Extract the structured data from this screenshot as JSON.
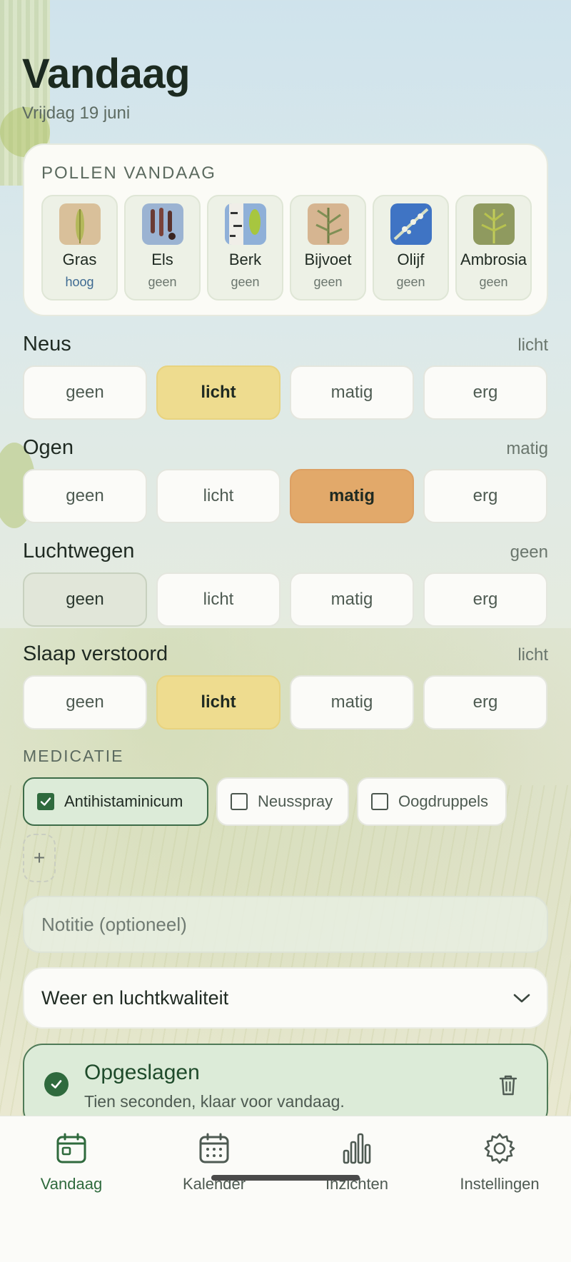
{
  "header": {
    "title": "Vandaag",
    "date": "Vrijdag 19 juni"
  },
  "pollen": {
    "heading": "POLLEN VANDAAG",
    "items": [
      {
        "name": "Gras",
        "level": "hoog",
        "icon": "grass-pollen-icon"
      },
      {
        "name": "Els",
        "level": "geen",
        "icon": "alder-pollen-icon"
      },
      {
        "name": "Berk",
        "level": "geen",
        "icon": "birch-pollen-icon"
      },
      {
        "name": "Bijvoet",
        "level": "geen",
        "icon": "mugwort-pollen-icon"
      },
      {
        "name": "Olijf",
        "level": "geen",
        "icon": "olive-pollen-icon"
      },
      {
        "name": "Ambrosia",
        "level": "geen",
        "icon": "ragweed-pollen-icon"
      }
    ]
  },
  "options": [
    "geen",
    "licht",
    "matig",
    "erg"
  ],
  "symptoms": [
    {
      "title": "Neus",
      "value": "licht"
    },
    {
      "title": "Ogen",
      "value": "matig"
    },
    {
      "title": "Luchtwegen",
      "value": "geen"
    },
    {
      "title": "Slaap verstoord",
      "value": "licht"
    }
  ],
  "medication": {
    "heading": "MEDICATIE",
    "items": [
      {
        "label": "Antihistaminicum",
        "checked": true
      },
      {
        "label": "Neusspray",
        "checked": false
      },
      {
        "label": "Oogdruppels",
        "checked": false
      }
    ],
    "add_label": "+"
  },
  "note": {
    "placeholder": "Notitie (optioneel)"
  },
  "weather": {
    "label": "Weer en luchtkwaliteit",
    "icon": "chevron-down-icon"
  },
  "saved": {
    "title": "Opgeslagen",
    "subtitle": "Tien seconden, klaar voor vandaag."
  },
  "nav": {
    "items": [
      {
        "label": "Vandaag",
        "icon": "calendar-today-icon",
        "active": true
      },
      {
        "label": "Kalender",
        "icon": "calendar-icon",
        "active": false
      },
      {
        "label": "Inzichten",
        "icon": "bar-chart-icon",
        "active": false
      },
      {
        "label": "Instellingen",
        "icon": "gear-icon",
        "active": false
      }
    ]
  },
  "colors": {
    "accent": "#2f6a3d",
    "licht": "#eedc8f",
    "matig": "#e2a96a",
    "geen_selected": "#e1e6d9"
  }
}
